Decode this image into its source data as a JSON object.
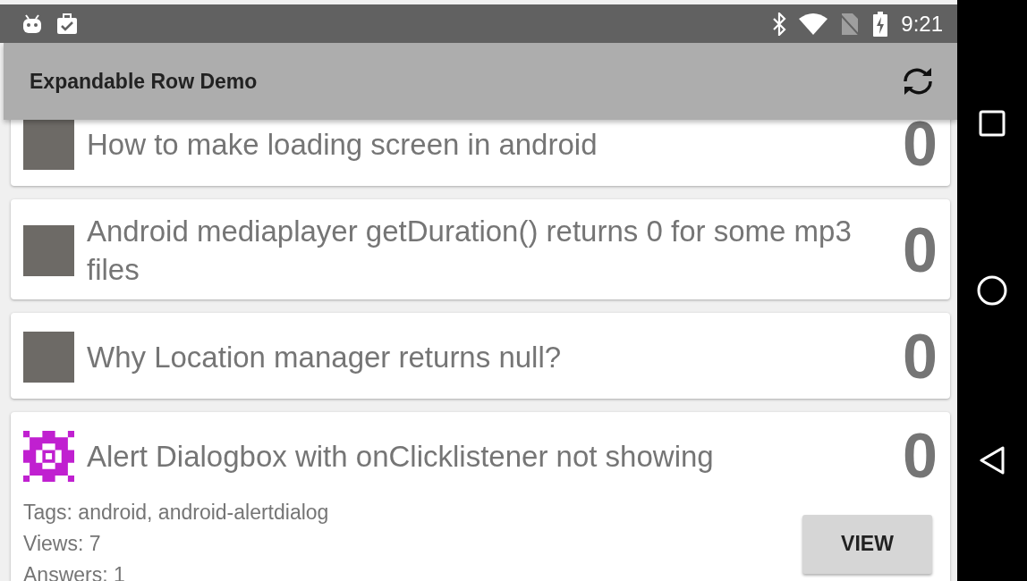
{
  "status_bar": {
    "time": "9:21"
  },
  "app_bar": {
    "title": "Expandable Row Demo"
  },
  "questions": [
    {
      "kind": "photo",
      "title": "How to make loading screen in android",
      "count": "0",
      "expanded": false
    },
    {
      "kind": "photo",
      "title": "Android mediaplayer getDuration() returns 0 for some mp3 files",
      "count": "0",
      "expanded": false
    },
    {
      "kind": "photo",
      "title": "Why Location manager returns null?",
      "count": "0",
      "expanded": false
    },
    {
      "kind": "identicon",
      "title": "Alert Dialogbox with onClicklistener not showing",
      "count": "0",
      "expanded": true,
      "tags": "Tags: android, android-alertdialog",
      "views": "Views: 7",
      "answers": "Answers: 1",
      "button": "VIEW"
    }
  ]
}
